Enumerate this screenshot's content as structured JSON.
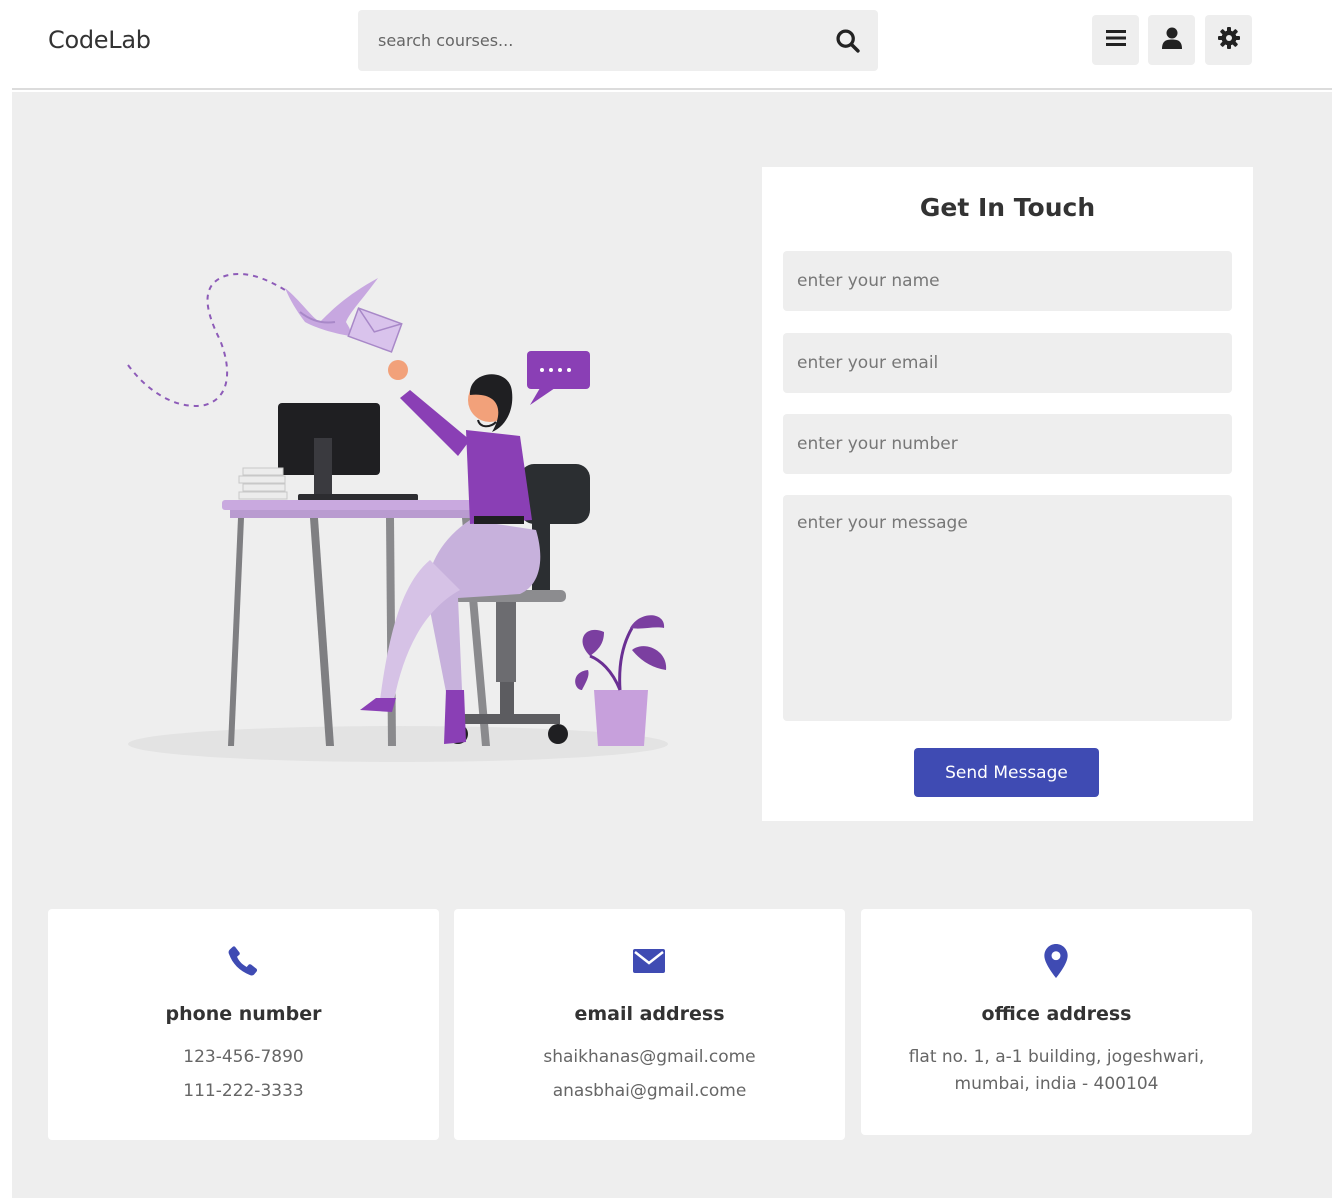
{
  "header": {
    "logo": "CodeLab",
    "search_placeholder": "search courses...",
    "icons": [
      "search-icon",
      "menu-icon",
      "user-icon",
      "gear-icon"
    ]
  },
  "contact_form": {
    "title": "Get In Touch",
    "name_placeholder": "enter your name",
    "email_placeholder": "enter your email",
    "number_placeholder": "enter your number",
    "message_placeholder": "enter your message",
    "submit_label": "Send Message"
  },
  "info_cards": [
    {
      "icon": "phone-icon",
      "title": "phone number",
      "lines": [
        "123-456-7890",
        "111-222-3333"
      ]
    },
    {
      "icon": "envelope-icon",
      "title": "email address",
      "lines": [
        "shaikhanas@gmail.come",
        "anasbhai@gmail.come"
      ]
    },
    {
      "icon": "map-marker-icon",
      "title": "office address",
      "lines": [
        "flat no. 1, a-1 building, jogeshwari,",
        "mumbai, india - 400104"
      ]
    }
  ],
  "colors": {
    "accent": "#3f4bb3",
    "page_background": "#eeeeee",
    "illustration_purple": "#7b3fa0"
  }
}
